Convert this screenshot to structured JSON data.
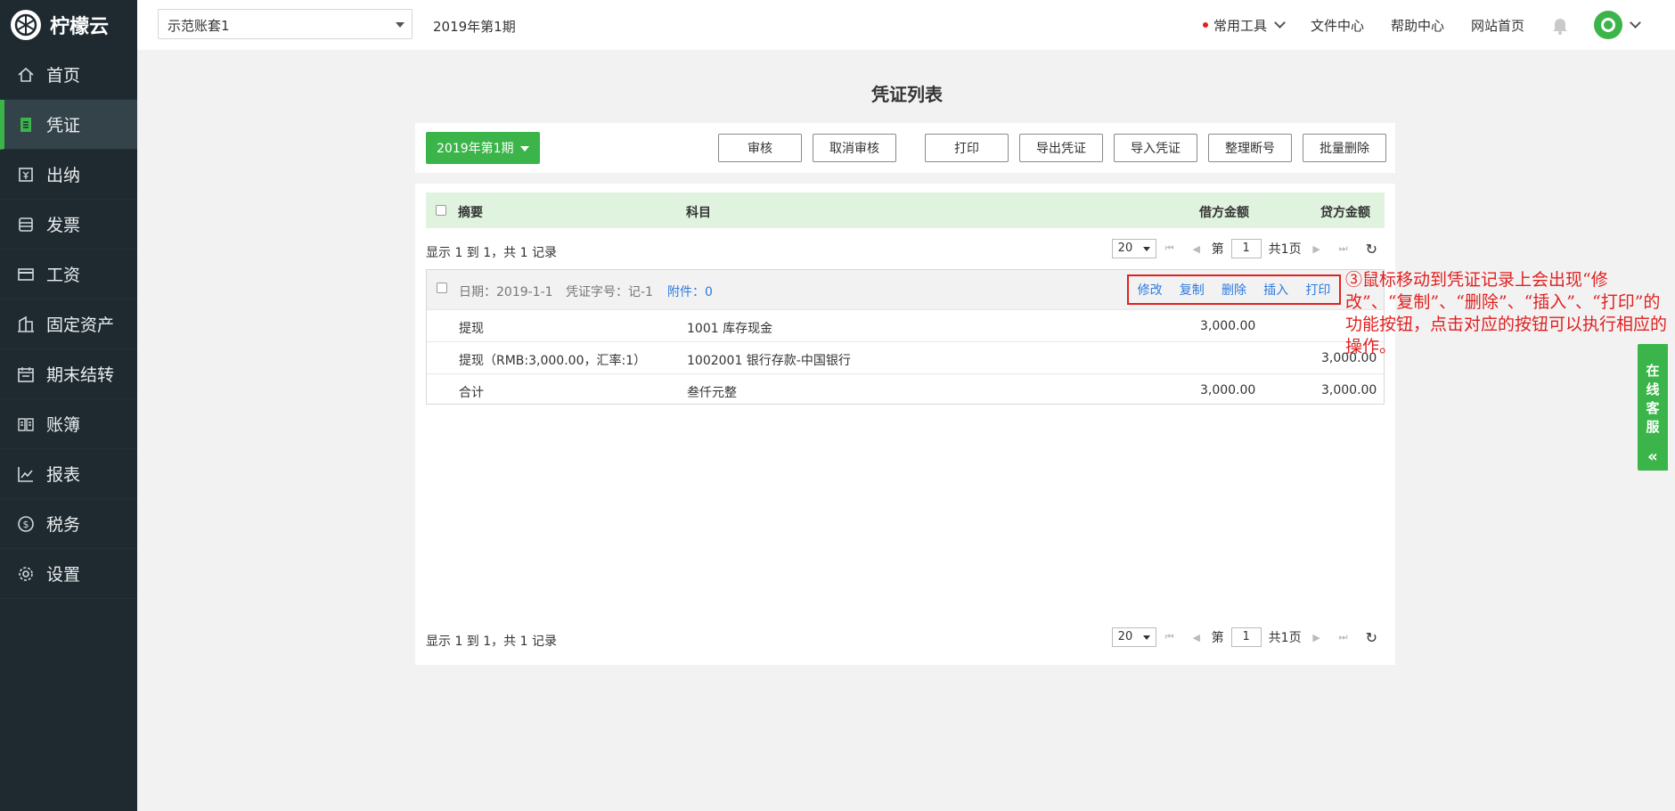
{
  "app": {
    "name": "柠檬云"
  },
  "sidebar": {
    "items": [
      {
        "label": "首页",
        "icon": "home-icon"
      },
      {
        "label": "凭证",
        "icon": "document-icon",
        "active": true
      },
      {
        "label": "出纳",
        "icon": "cashier-icon"
      },
      {
        "label": "发票",
        "icon": "invoice-icon"
      },
      {
        "label": "工资",
        "icon": "card-icon"
      },
      {
        "label": "固定资产",
        "icon": "building-icon"
      },
      {
        "label": "期末结转",
        "icon": "calendar-icon"
      },
      {
        "label": "账簿",
        "icon": "book-icon"
      },
      {
        "label": "报表",
        "icon": "chart-icon"
      },
      {
        "label": "税务",
        "icon": "dollar-icon"
      },
      {
        "label": "设置",
        "icon": "gear-icon"
      }
    ]
  },
  "topbar": {
    "account_select": "示范账套1",
    "period": "2019年第1期",
    "links": {
      "tools": "常用工具",
      "files": "文件中心",
      "help": "帮助中心",
      "site": "网站首页"
    }
  },
  "page": {
    "title": "凭证列表"
  },
  "toolbar": {
    "period_button": "2019年第1期",
    "buttons": {
      "audit": "审核",
      "cancel_audit": "取消审核",
      "print": "打印",
      "export": "导出凭证",
      "import": "导入凭证",
      "renumber": "整理断号",
      "batch_delete": "批量删除"
    }
  },
  "table": {
    "headers": {
      "summary": "摘要",
      "subject": "科目",
      "debit": "借方金额",
      "credit": "贷方金额"
    },
    "pager": {
      "info": "显示 1 到 1，共 1 记录",
      "page_size": "20",
      "page_prefix": "第",
      "page": "1",
      "total_pages": "共1页"
    },
    "voucher": {
      "date": "日期：2019-1-1",
      "number": "凭证字号：记-1",
      "attachments": "附件：0",
      "actions": {
        "edit": "修改",
        "copy": "复制",
        "delete": "删除",
        "insert": "插入",
        "print": "打印"
      },
      "rows": [
        {
          "summary": "提现",
          "subject": "1001 库存现金",
          "debit": "3,000.00",
          "credit": ""
        },
        {
          "summary": "提现（RMB:3,000.00，汇率:1）",
          "subject": "1002001 银行存款-中国银行",
          "debit": "",
          "credit": "3,000.00"
        },
        {
          "summary": "合计",
          "subject": "叁仟元整",
          "debit": "3,000.00",
          "credit": "3,000.00"
        }
      ]
    }
  },
  "annotation": "③鼠标移动到凭证记录上会出现“修改”、“复制”、“删除”、“插入”、“打印”的功能按钮，点击对应的按钮可以执行相应的操作。",
  "service": {
    "label": "在线客服"
  },
  "colors": {
    "brand_green": "#3bb54a",
    "sidebar_bg": "#1f2a30",
    "link_blue": "#2d7be0",
    "annotation_red": "#e02020",
    "header_green": "#dff3de"
  }
}
